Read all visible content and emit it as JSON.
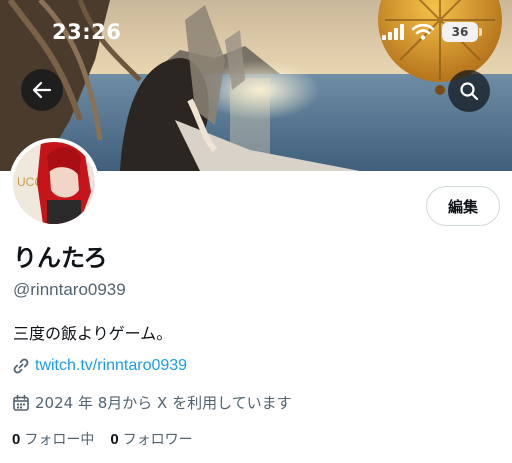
{
  "status_bar": {
    "time": "23:26",
    "battery": "36",
    "icons": [
      "signal-icon",
      "wifi-icon",
      "battery-icon"
    ]
  },
  "header": {
    "back_icon": "arrow-left-icon",
    "search_icon": "search-icon"
  },
  "profile": {
    "edit_label": "編集",
    "display_name": "りんたろ",
    "handle": "@rinntaro0939",
    "bio": "三度の飯よりゲーム。",
    "link": "twitch.tv/rinntaro0939",
    "joined": "2024 年 8月から X を利用しています",
    "following_count": "0",
    "following_label": "フォロー中",
    "followers_count": "0",
    "followers_label": "フォロワー"
  },
  "colors": {
    "link": "#1d9bf0",
    "secondary_text": "#536471",
    "primary_text": "#0f1419"
  }
}
